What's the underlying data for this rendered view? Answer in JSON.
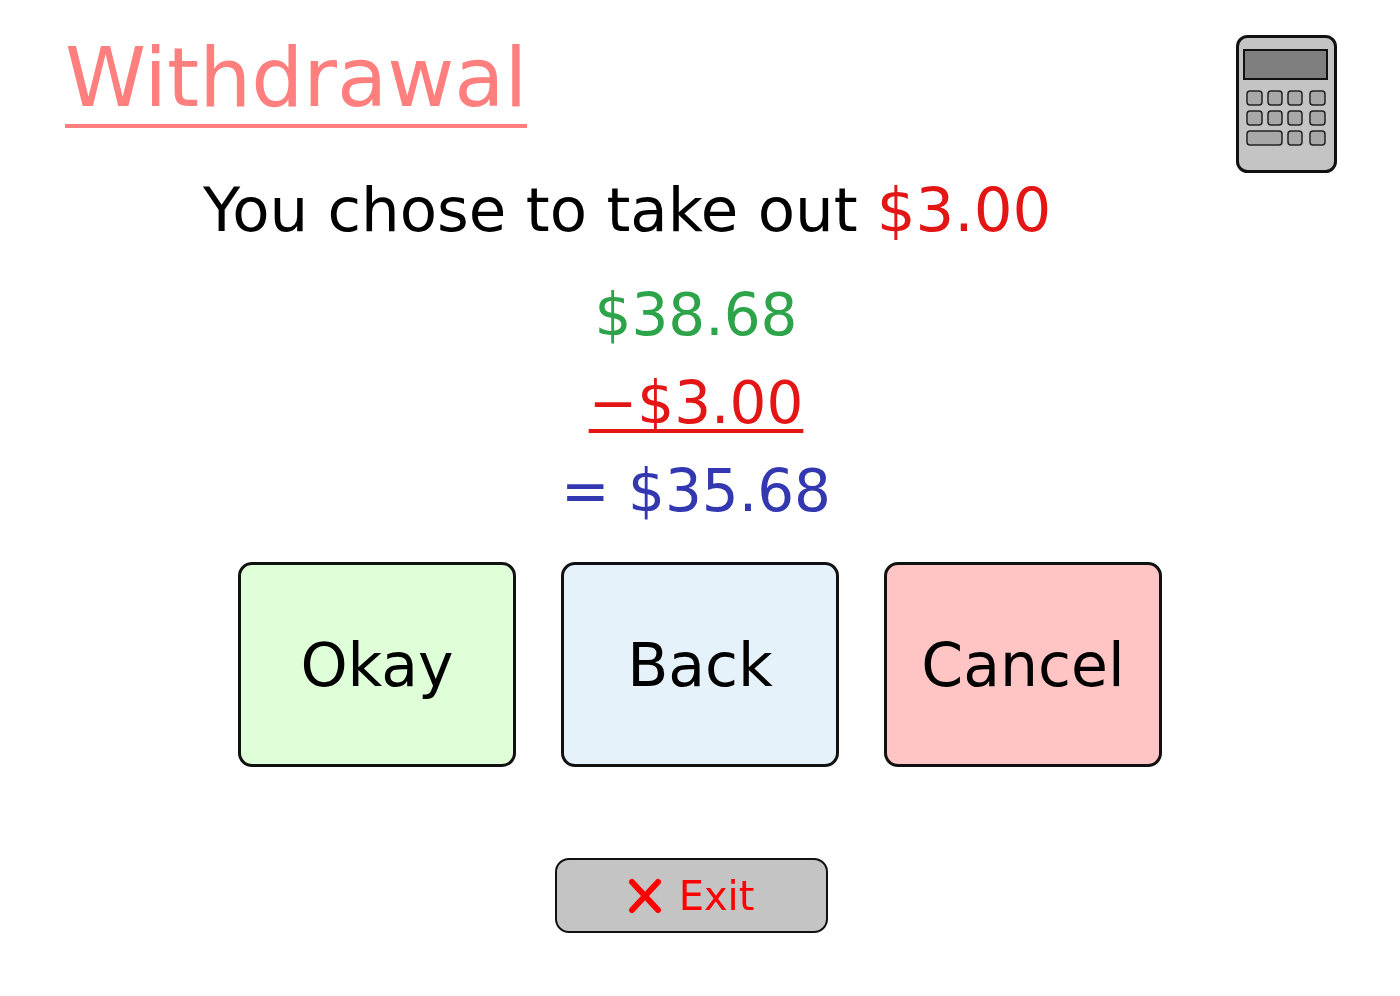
{
  "title": "Withdrawal",
  "summary": {
    "prompt": "You chose to take out",
    "amount": "$3.00"
  },
  "calculation": {
    "balance": "$38.68",
    "withdrawal": "−$3.00",
    "result": "= $35.68"
  },
  "buttons": [
    {
      "label": "Okay",
      "color": "#dfffd8"
    },
    {
      "label": "Back",
      "color": "#e6f2fa"
    },
    {
      "label": "Cancel",
      "color": "#ffc5c5"
    }
  ],
  "exit_button": {
    "label": "Exit"
  }
}
